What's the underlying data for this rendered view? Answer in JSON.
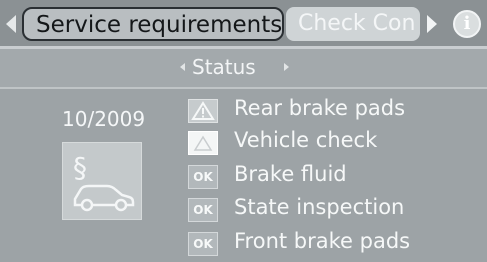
{
  "header": {
    "active_tab": "Service requirements",
    "next_tab": "Check Cont",
    "info_symbol": "i"
  },
  "status_bar": {
    "title": "Status"
  },
  "left_panel": {
    "date": "10/2009",
    "icon": "service-car-icon"
  },
  "items": [
    {
      "label": "Rear brake pads",
      "status": "warning",
      "badge": "warning-triangle-icon"
    },
    {
      "label": "Vehicle check",
      "status": "warning",
      "badge": "warning-triangle-icon"
    },
    {
      "label": "Brake fluid",
      "status": "ok",
      "badge_text": "OK"
    },
    {
      "label": "State inspection",
      "status": "ok",
      "badge_text": "OK"
    },
    {
      "label": "Front brake pads",
      "status": "ok",
      "badge_text": "OK"
    }
  ],
  "colors": {
    "background": "#9da3a6",
    "active_tab": "#b9bec1",
    "text": "#f5f7f8"
  }
}
